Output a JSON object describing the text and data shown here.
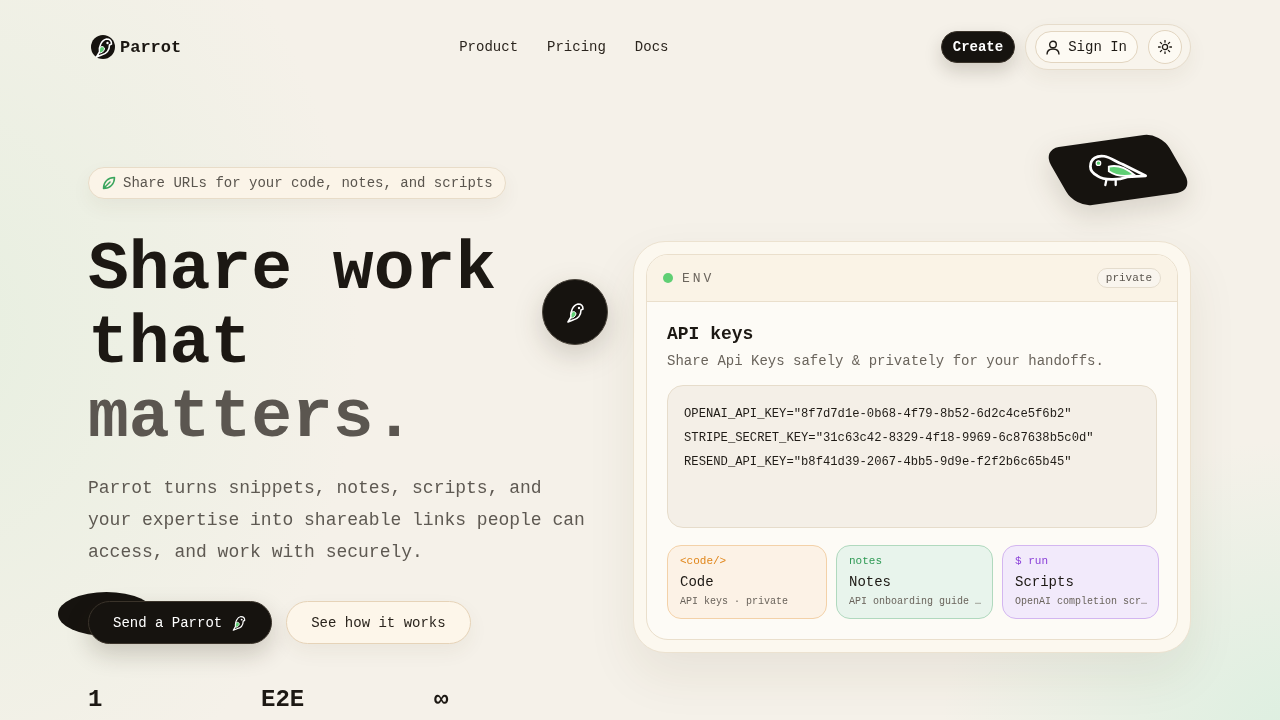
{
  "header": {
    "logo": "Parrot",
    "nav": [
      "Product",
      "Pricing",
      "Docs"
    ],
    "create_button": "Create",
    "sign_in_button": "Sign In"
  },
  "hero": {
    "badge": "Share URLs for your code, notes, and scripts",
    "headline": [
      {
        "text": "Share work that ",
        "muted": false
      },
      {
        "text": "matters.",
        "muted": true
      }
    ],
    "description": "Parrot turns snippets, notes, scripts, and your expertise into shareable links people can access, and work with securely.",
    "buttons": [
      {
        "label": "Send a Parrot",
        "kind": "primary"
      },
      {
        "label": "See how it works",
        "kind": "secondary"
      }
    ],
    "stats": [
      {
        "value": "1"
      },
      {
        "value": "E2E"
      },
      {
        "value": "∞"
      }
    ]
  },
  "preview": {
    "env": {
      "online": true,
      "label": "ENV",
      "tag": "private"
    },
    "title": "API keys",
    "subtitle": "Share Api Keys safely & privately for your handoffs.",
    "code_lines": [
      "OPENAI_API_KEY=\"8f7d7d1e-0b68-4f79-8b52-6d2c4ce5f6b2\"",
      "STRIPE_SECRET_KEY=\"31c63c42-8329-4f18-9969-6c87638b5c0d\"",
      "RESEND_API_KEY=\"b8f41d39-2067-4bb5-9d9e-f2f2b6c65b45\""
    ],
    "cards": [
      {
        "tag": "<code/>",
        "title": "Code",
        "subtitle": "API keys · private",
        "color": "#e0861a"
      },
      {
        "tag": "notes",
        "title": "Notes",
        "subtitle": "API onboarding guide …",
        "color": "#2f9a55"
      },
      {
        "tag": "$ run",
        "title": "Scripts",
        "subtitle": "OpenAI completion scr…",
        "color": "#8a3fd8"
      }
    ]
  }
}
